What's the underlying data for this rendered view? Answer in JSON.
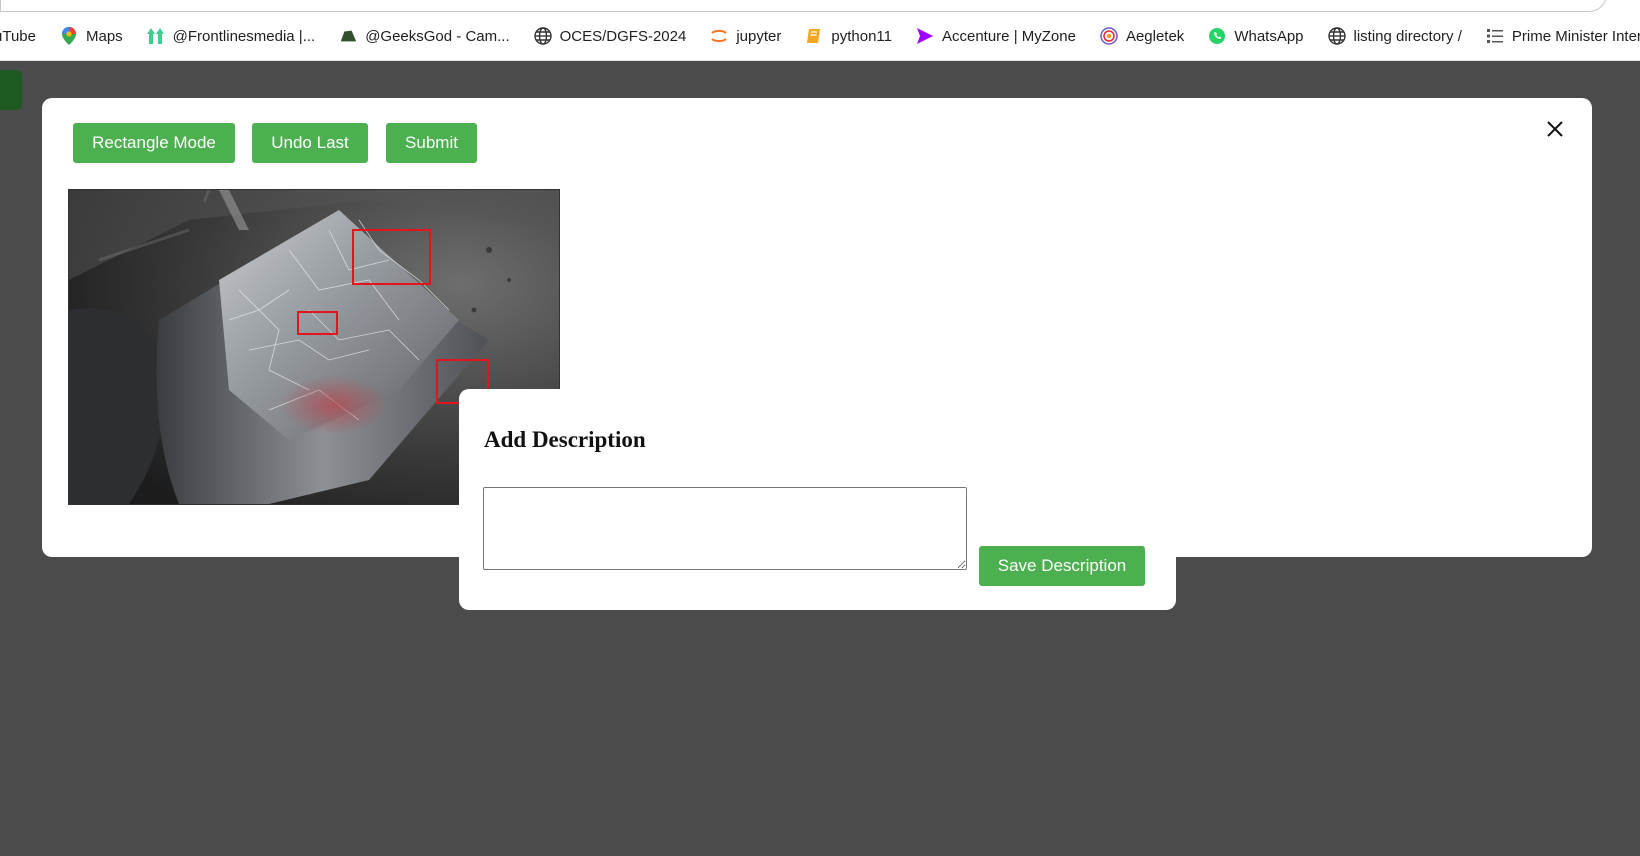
{
  "browser": {
    "bookmarks": [
      {
        "label": "uTube",
        "icon": "youtube-icon"
      },
      {
        "label": "Maps",
        "icon": "maps-pin-icon"
      },
      {
        "label": "@Frontlinesmedia |...",
        "icon": "frontlines-logo-icon"
      },
      {
        "label": "@GeeksGod - Cam...",
        "icon": "geeksgod-logo-icon"
      },
      {
        "label": "OCES/DGFS-2024",
        "icon": "globe-icon"
      },
      {
        "label": "jupyter",
        "icon": "jupyter-icon"
      },
      {
        "label": "python11",
        "icon": "notebook-icon"
      },
      {
        "label": "Accenture | MyZone",
        "icon": "accenture-arrow-icon"
      },
      {
        "label": "Aegletek",
        "icon": "aegletek-logo-icon"
      },
      {
        "label": "WhatsApp",
        "icon": "whatsapp-icon"
      },
      {
        "label": "listing directory /",
        "icon": "globe-icon"
      },
      {
        "label": "Prime Minister Inter...",
        "icon": "list-icon"
      }
    ]
  },
  "modal": {
    "buttons": {
      "rectangle_mode": "Rectangle Mode",
      "undo_last": "Undo Last",
      "submit": "Submit"
    },
    "close_icon": "close-icon",
    "image": {
      "annotation_color": "#e3151a",
      "annotation_count": 3
    }
  },
  "popup": {
    "title": "Add Description",
    "textarea_value": "",
    "save_button": "Save Description"
  },
  "colors": {
    "accent": "#4caf50",
    "overlay": "#4b4b4b",
    "annotation": "#e3151a"
  }
}
